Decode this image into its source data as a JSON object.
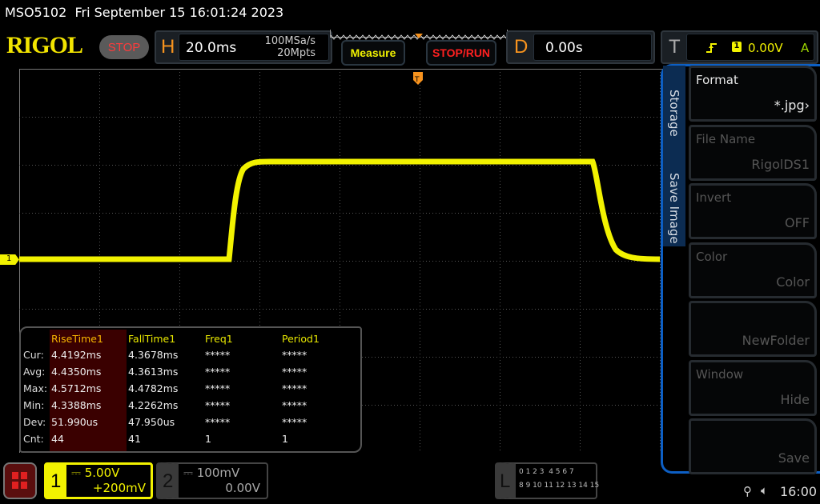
{
  "titlebar": {
    "model": "MSO5102",
    "datetime": "Fri September 15 16:01:24 2023"
  },
  "header": {
    "logo": "RIGOL",
    "run_state": "STOP",
    "horizontal": {
      "label": "H",
      "timebase": "20.0ms",
      "sample_rate": "100MSa/s",
      "memory_depth": "20Mpts"
    },
    "measure_button": "Measure",
    "stop_run_button": "STOP/RUN",
    "delay": {
      "label": "D",
      "value": "0.00s"
    },
    "trigger": {
      "label": "T",
      "source": "1",
      "level": "0.00V",
      "mode": "A",
      "slope_icon": "rising-edge-icon"
    }
  },
  "waveform": {
    "channel_marker": "1",
    "color": "#f2f200"
  },
  "side_menu": {
    "tabs": [
      "Storage",
      "Save Image"
    ],
    "items": [
      {
        "title": "Format",
        "value": "*.jpg",
        "has_arrow": true,
        "enabled": true
      },
      {
        "title": "File Name",
        "value": "RigolDS1",
        "enabled": false
      },
      {
        "title": "Invert",
        "value": "OFF",
        "enabled": false
      },
      {
        "title": "Color",
        "value": "Color",
        "enabled": false
      },
      {
        "title": "",
        "value": "NewFolder",
        "enabled": false
      },
      {
        "title": "Window",
        "value": "Hide",
        "enabled": false
      },
      {
        "title": "",
        "value": "Save",
        "enabled": false
      }
    ]
  },
  "measurements": {
    "columns": [
      "RiseTime1",
      "FallTime1",
      "Freq1",
      "Period1"
    ],
    "rows": [
      {
        "label": "Cur:",
        "values": [
          "4.4192ms",
          "4.3678ms",
          "*****",
          "*****"
        ]
      },
      {
        "label": "Avg:",
        "values": [
          "4.4350ms",
          "4.3613ms",
          "*****",
          "*****"
        ]
      },
      {
        "label": "Max:",
        "values": [
          "4.5712ms",
          "4.4782ms",
          "*****",
          "*****"
        ]
      },
      {
        "label": "Min:",
        "values": [
          "4.3388ms",
          "4.2262ms",
          "*****",
          "*****"
        ]
      },
      {
        "label": "Dev:",
        "values": [
          "51.990us",
          "47.950us",
          "*****",
          "*****"
        ]
      },
      {
        "label": "Cnt:",
        "values": [
          "44",
          "41",
          "1",
          "1"
        ]
      }
    ]
  },
  "bottom": {
    "ch1": {
      "num": "1",
      "scale": "5.00V",
      "offset": "+200mV"
    },
    "ch2": {
      "num": "2",
      "scale": "100mV",
      "offset": "0.00V"
    },
    "logic": {
      "label": "L",
      "row1": "0 1 2 3  4 5 6 7",
      "row2": "8 9 10 11 12 13 14 15"
    },
    "time": "16:00"
  }
}
